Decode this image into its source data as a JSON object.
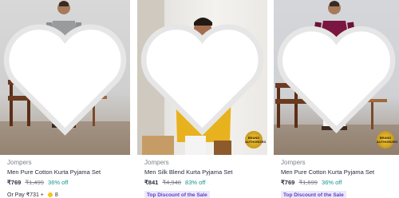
{
  "colors": {
    "discount": "#14958f",
    "deal_bg": "#ece8fb",
    "deal_text": "#5b3fc4",
    "coin": "#f5c518"
  },
  "products": [
    {
      "brand": "Jompers",
      "name": "Men Pure Cotton Kurta Pyjama Set",
      "price": "₹769",
      "mrp": "₹1,499",
      "discount": "36% off",
      "pay_text": "Or Pay ₹731 +",
      "coins": "8",
      "kurta_color": "#9a9b9d",
      "icons": [
        "heart-icon"
      ]
    },
    {
      "brand": "Jompers",
      "name": "Men Silk Blend Kurta Pyjama Set",
      "price": "₹841",
      "mrp": "₹4,948",
      "discount": "83% off",
      "deal": "Top Discount of the Sale",
      "badge": "BRAND AUTHORIZED",
      "kurta_color": "#e8b21e",
      "icons": [
        "heart-icon",
        "brand-badge-icon"
      ]
    },
    {
      "brand": "Jompers",
      "name": "Men Pure Cotton Kurta Pyjama Set",
      "price": "₹769",
      "mrp": "₹1,699",
      "discount": "36% off",
      "deal": "Top Discount of the Sale",
      "badge": "BRAND AUTHORIZED",
      "kurta_color": "#7b1640",
      "icons": [
        "heart-icon",
        "brand-badge-icon"
      ]
    }
  ]
}
